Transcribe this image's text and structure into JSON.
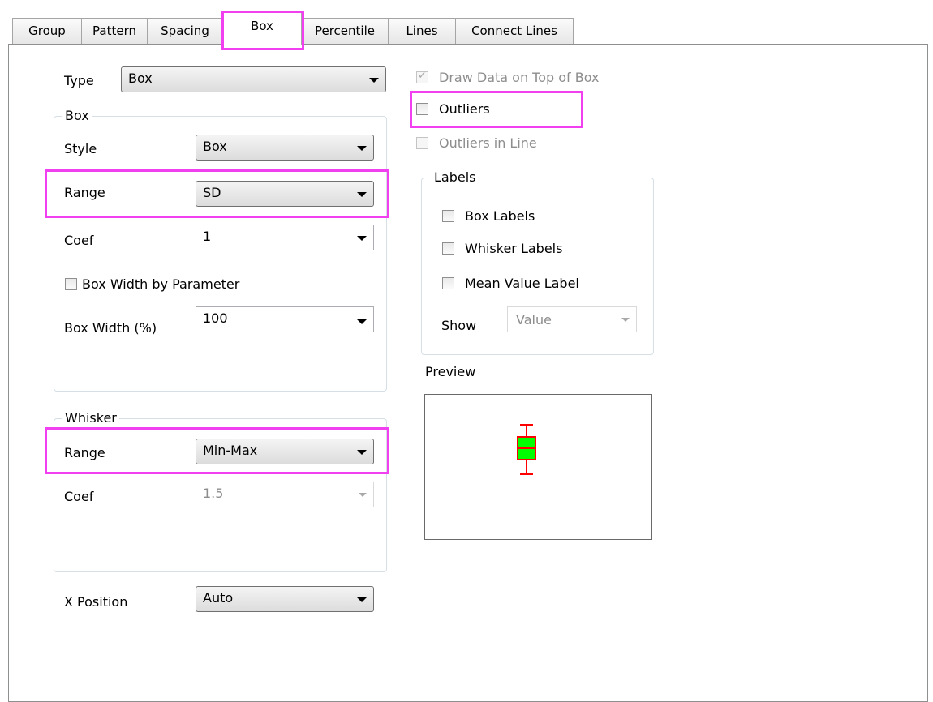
{
  "tabs": [
    {
      "label": "Group"
    },
    {
      "label": "Pattern"
    },
    {
      "label": "Spacing"
    },
    {
      "label": "Box"
    },
    {
      "label": "Percentile"
    },
    {
      "label": "Lines"
    },
    {
      "label": "Connect Lines"
    }
  ],
  "type": {
    "label": "Type",
    "value": "Box"
  },
  "box_group": {
    "title": "Box",
    "style": {
      "label": "Style",
      "value": "Box"
    },
    "range": {
      "label": "Range",
      "value": "SD"
    },
    "coef": {
      "label": "Coef",
      "value": "1"
    },
    "width_by_param": {
      "label": "Box Width by Parameter"
    },
    "box_width": {
      "label": "Box Width (%)",
      "value": "100"
    }
  },
  "whisker_group": {
    "title": "Whisker",
    "range": {
      "label": "Range",
      "value": "Min-Max"
    },
    "coef": {
      "label": "Coef",
      "value": "1.5"
    }
  },
  "x_position": {
    "label": "X Position",
    "value": "Auto"
  },
  "options": {
    "draw_data_on_top": {
      "label": "Draw Data on Top of Box"
    },
    "outliers": {
      "label": "Outliers"
    },
    "outliers_in_line": {
      "label": "Outliers in Line"
    }
  },
  "labels_group": {
    "title": "Labels",
    "box_labels": "Box Labels",
    "whisker_labels": "Whisker Labels",
    "mean_value_label": "Mean Value Label",
    "show": {
      "label": "Show",
      "value": "Value"
    }
  },
  "preview": {
    "title": "Preview"
  },
  "colors": {
    "highlight": "#f040f0",
    "box_fill": "#00ff00",
    "whisker": "#ff0000"
  }
}
